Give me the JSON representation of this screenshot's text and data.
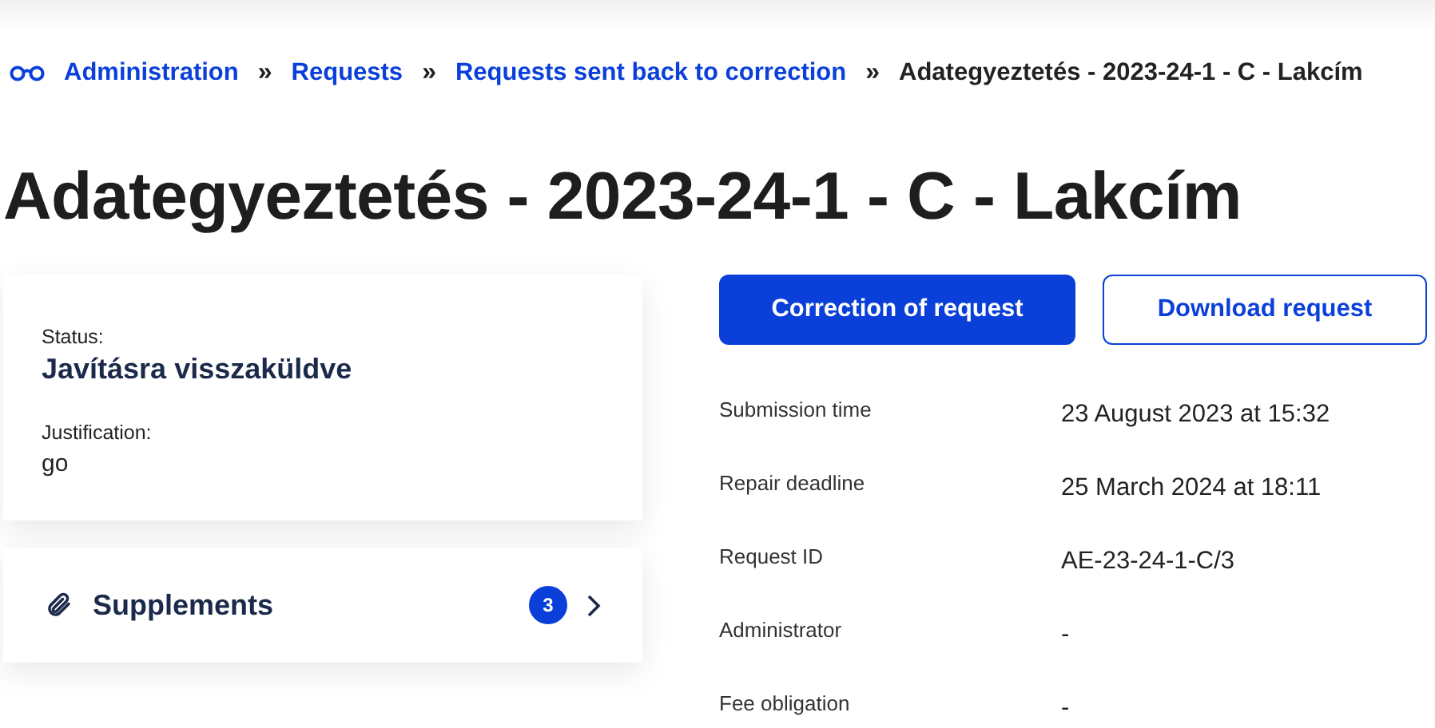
{
  "breadcrumb": [
    {
      "label": "Administration",
      "kind": "link"
    },
    {
      "label": "Requests",
      "kind": "link"
    },
    {
      "label": "Requests sent back to correction",
      "kind": "link"
    },
    {
      "label": "Adategyeztetés - 2023-24-1 - C - Lakcím",
      "kind": "current"
    }
  ],
  "breadcrumb_separator": "»",
  "title": "Adategyeztetés - 2023-24-1 - C - Lakcím",
  "status_card": {
    "status_label": "Status:",
    "status": "Javításra visszaküldve",
    "justification_label": "Justification:",
    "justification": "go"
  },
  "supplements": {
    "label": "Supplements",
    "count": "3"
  },
  "buttons": [
    {
      "label": "Correction of request",
      "kind": "primary"
    },
    {
      "label": "Download request",
      "kind": "secondary"
    }
  ],
  "details": [
    {
      "label": "Submission time",
      "value": "23 August 2023 at 15:32"
    },
    {
      "label": "Repair deadline",
      "value": "25 March 2024 at 18:11"
    },
    {
      "label": "Request ID",
      "value": "AE-23-24-1-C/3"
    },
    {
      "label": "Administrator",
      "value": "-"
    },
    {
      "label": "Fee obligation",
      "value": "-"
    }
  ]
}
